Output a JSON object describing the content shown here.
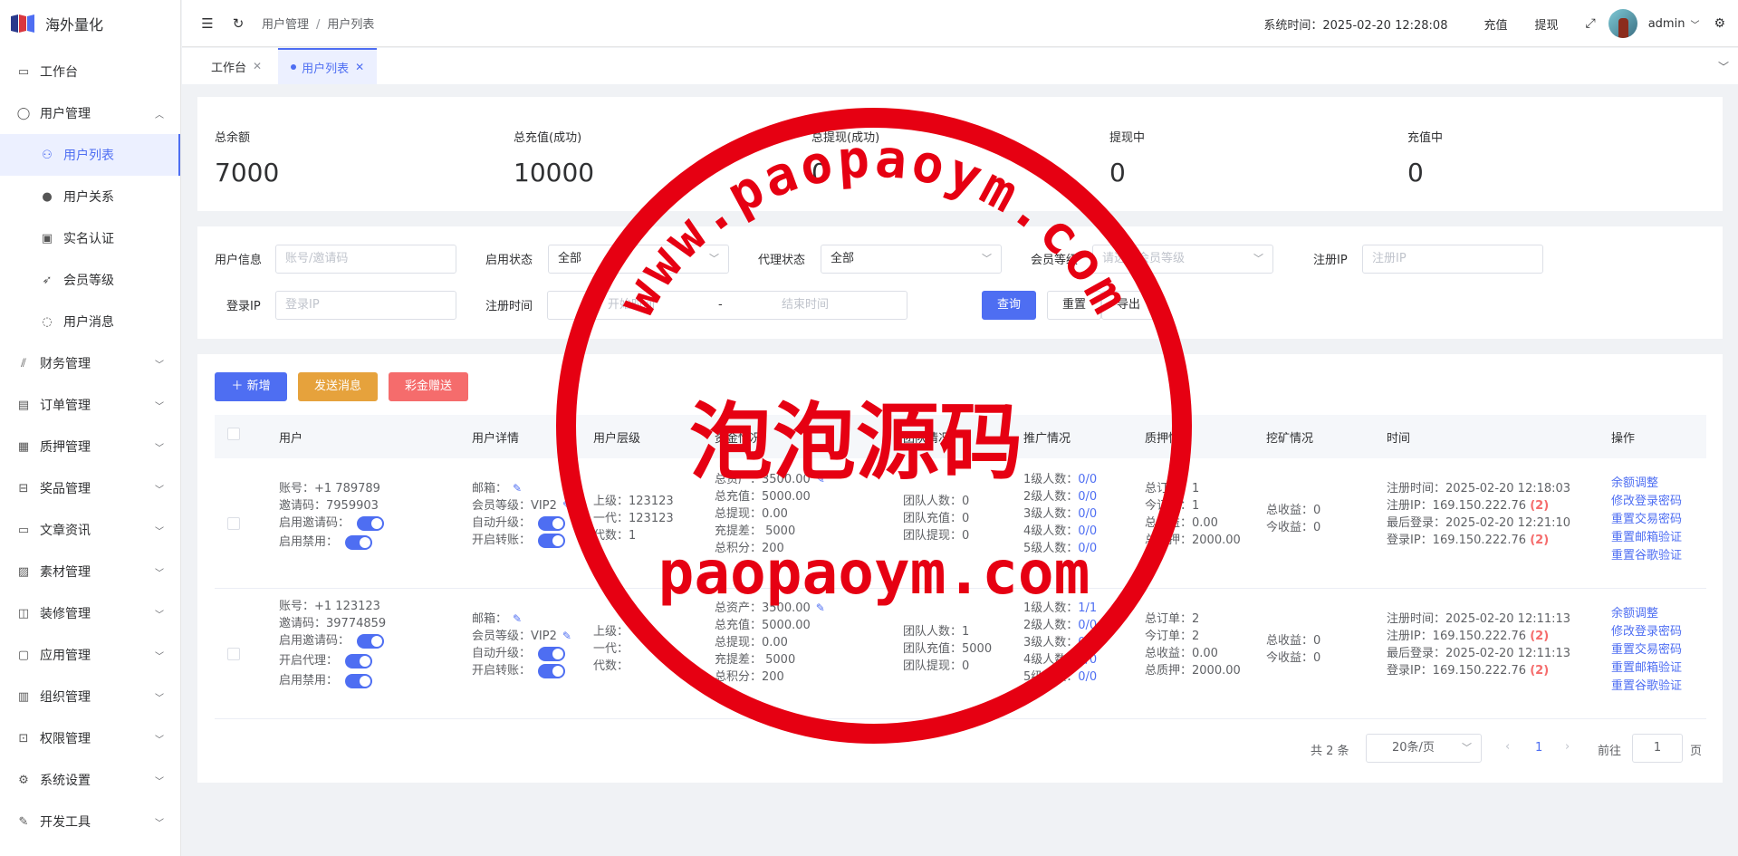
{
  "app": {
    "name": "海外量化"
  },
  "sidebar": {
    "items": [
      {
        "label": "工作台",
        "icon": "monitor-icon"
      },
      {
        "label": "用户管理",
        "icon": "user-icon",
        "expanded": true
      },
      {
        "label": "财务管理",
        "icon": "chart-icon"
      },
      {
        "label": "订单管理",
        "icon": "order-icon"
      },
      {
        "label": "质押管理",
        "icon": "pledge-icon"
      },
      {
        "label": "奖品管理",
        "icon": "gift-icon"
      },
      {
        "label": "文章资讯",
        "icon": "article-icon"
      },
      {
        "label": "素材管理",
        "icon": "image-icon"
      },
      {
        "label": "装修管理",
        "icon": "decor-icon"
      },
      {
        "label": "应用管理",
        "icon": "app-icon"
      },
      {
        "label": "组织管理",
        "icon": "org-icon"
      },
      {
        "label": "权限管理",
        "icon": "lock-icon"
      },
      {
        "label": "系统设置",
        "icon": "gear-icon"
      },
      {
        "label": "开发工具",
        "icon": "tool-icon"
      }
    ],
    "sub_items": [
      {
        "label": "用户列表",
        "icon": "user-list-icon",
        "active": true
      },
      {
        "label": "用户关系",
        "icon": "relation-icon"
      },
      {
        "label": "实名认证",
        "icon": "id-card-icon"
      },
      {
        "label": "会员等级",
        "icon": "rocket-icon"
      },
      {
        "label": "用户消息",
        "icon": "message-icon"
      }
    ]
  },
  "header": {
    "breadcrumb": [
      "用户管理",
      "用户列表"
    ],
    "system_time_label": "系统时间：",
    "system_time": "2025-02-20 12:28:08",
    "recharge": "充值",
    "withdraw": "提现",
    "username": "admin"
  },
  "tabs": [
    {
      "label": "工作台",
      "active": false
    },
    {
      "label": "用户列表",
      "active": true
    }
  ],
  "stats": [
    {
      "label": "总余额",
      "value": "7000"
    },
    {
      "label": "总充值(成功)",
      "value": "10000"
    },
    {
      "label": "总提现(成功)",
      "value": "0"
    },
    {
      "label": "提现中",
      "value": "0"
    },
    {
      "label": "充值中",
      "value": "0"
    }
  ],
  "filters": {
    "user_info_label": "用户信息",
    "user_info_placeholder": "账号/邀请码",
    "enable_status_label": "启用状态",
    "enable_status_value": "全部",
    "agent_status_label": "代理状态",
    "agent_status_value": "全部",
    "member_level_label": "会员等级",
    "member_level_placeholder": "请选择会员等级",
    "reg_ip_label": "注册IP",
    "reg_ip_placeholder": "注册IP",
    "login_ip_label": "登录IP",
    "login_ip_placeholder": "登录IP",
    "reg_time_label": "注册时间",
    "start_placeholder": "开始时间",
    "range_sep": "-",
    "end_placeholder": "结束时间",
    "query": "查询",
    "reset": "重置",
    "export": "导出"
  },
  "actions": {
    "add": "新增",
    "send_message": "发送消息",
    "lottery_gift": "彩金赠送"
  },
  "table": {
    "headers": [
      "用户",
      "用户详情",
      "用户层级",
      "资金情况",
      "团队情况",
      "推广情况",
      "质押情况",
      "挖矿情况",
      "时间",
      "操作"
    ],
    "rows": [
      {
        "user": [
          "账号：+1 789789",
          "邀请码：7959903",
          "启用邀请码：",
          "启用禁用："
        ],
        "detail": [
          "邮箱：",
          "会员等级：VIP2",
          "自动升级：",
          "开启转账："
        ],
        "level": [
          "上级：123123",
          "一代：123123",
          "代数：1"
        ],
        "funds": [
          "总资产：3500.00",
          "总充值：5000.00",
          "总提现：0.00",
          "充提差：  5000",
          "总积分：200"
        ],
        "team": [
          "团队人数：0",
          "团队充值：0",
          "团队提现：0"
        ],
        "promo_labels": [
          "1级人数：",
          "2级人数：",
          "3级人数：",
          "4级人数：",
          "5级人数："
        ],
        "promo_values": [
          "0/0",
          "0/0",
          "0/0",
          "0/0",
          "0/0"
        ],
        "pledge": [
          "总订单：1",
          "今订单：1",
          "总收益：0.00",
          "总质押：2000.00"
        ],
        "mining": [
          "总收益：0",
          "今收益：0"
        ],
        "times": [
          "注册时间：2025-02-20 12:18:03",
          "注册IP：169.150.222.76",
          "最后登录：2025-02-20 12:21:10",
          "登录IP：169.150.222.76"
        ],
        "ip_count": "(2)"
      },
      {
        "user": [
          "账号：+1 123123",
          "邀请码：39774859",
          "启用邀请码：",
          "开启代理：",
          "启用禁用："
        ],
        "detail": [
          "邮箱：",
          "会员等级：VIP2",
          "自动升级：",
          "开启转账："
        ],
        "level": [
          "上级：",
          "一代：",
          "代数："
        ],
        "funds": [
          "总资产：3500.00",
          "总充值：5000.00",
          "总提现：0.00",
          "充提差：  5000",
          "总积分：200"
        ],
        "team": [
          "团队人数：1",
          "团队充值：5000",
          "团队提现：0"
        ],
        "promo_labels": [
          "1级人数：",
          "2级人数：",
          "3级人数：",
          "4级人数：",
          "5级人数："
        ],
        "promo_values": [
          "1/1",
          "0/0",
          "0/0",
          "0/0",
          "0/0"
        ],
        "pledge": [
          "总订单：2",
          "今订单：2",
          "总收益：0.00",
          "总质押：2000.00"
        ],
        "mining": [
          "总收益：0",
          "今收益：0"
        ],
        "times": [
          "注册时间：2025-02-20 12:11:13",
          "注册IP：169.150.222.76",
          "最后登录：2025-02-20 12:11:13",
          "登录IP：169.150.222.76"
        ],
        "ip_count": "(2)"
      }
    ],
    "operations": [
      "余额调整",
      "修改登录密码",
      "重置交易密码",
      "重置邮箱验证",
      "重置谷歌验证"
    ]
  },
  "pagination": {
    "total": "共 2 条",
    "page_size": "20条/页",
    "current": "1",
    "goto_label": "前往",
    "goto_value": "1",
    "page_suffix": "页"
  },
  "watermark": {
    "url_text": "www.paopaoym.com",
    "title": "泡泡源码",
    "domain": "paopaoym.com",
    "color": "#e60012"
  },
  "colors": {
    "primary": "#4e6ef2",
    "orange": "#e6a23c",
    "red": "#f56c6c"
  }
}
